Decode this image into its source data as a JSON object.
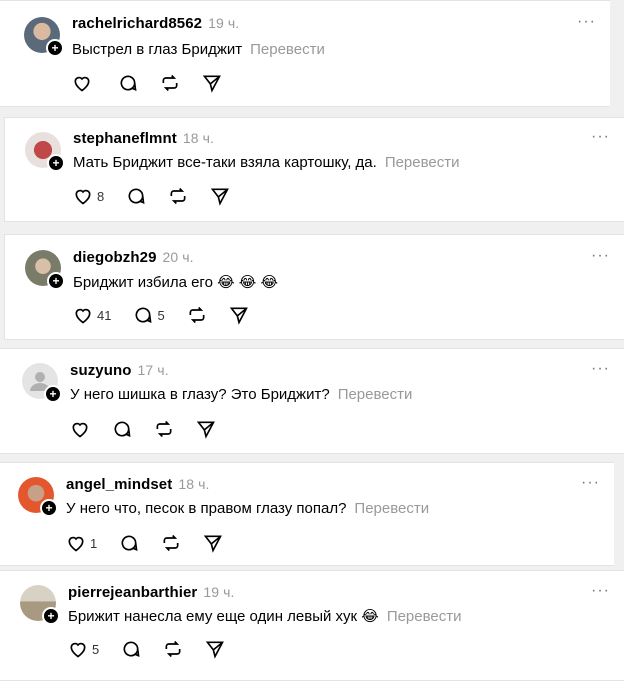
{
  "more_menu": "···",
  "translate_label": "Перевести",
  "comments": [
    {
      "user": "rachelrichard8562",
      "time": "19 ч.",
      "text": "Выстрел в глаз Бриджит",
      "translate": true,
      "emoji": "",
      "likes": "",
      "replies": ""
    },
    {
      "user": "stephaneflmnt",
      "time": "18 ч.",
      "text": "Мать Бриджит все-таки взяла картошку, да.",
      "translate": true,
      "emoji": "",
      "likes": "8",
      "replies": ""
    },
    {
      "user": "diegobzh29",
      "time": "20 ч.",
      "text": "Бриджит избила его",
      "translate": false,
      "emoji": "😂 😂 😂",
      "likes": "41",
      "replies": "5"
    },
    {
      "user": "suzyuno",
      "time": "17 ч.",
      "text": "У него шишка в глазу? Это Бриджит?",
      "translate": true,
      "emoji": "",
      "likes": "",
      "replies": ""
    },
    {
      "user": "angel_mindset",
      "time": "18 ч.",
      "text": "У него что, песок в правом глазу попал?",
      "translate": true,
      "emoji": "",
      "likes": "1",
      "replies": ""
    },
    {
      "user": "pierrejeanbarthier",
      "time": "19 ч.",
      "text": "Брижит нанесла ему еще один левый хук",
      "translate": true,
      "emoji": "😂",
      "likes": "5",
      "replies": ""
    }
  ],
  "colors": {
    "avatar_1": "#5a6a7a",
    "avatar_2": "#c9a0a0",
    "avatar_3": "#7b7b6a",
    "avatar_4": "#e4e4e4",
    "avatar_5": "#e4572e",
    "avatar_6": "#b8a88a"
  }
}
